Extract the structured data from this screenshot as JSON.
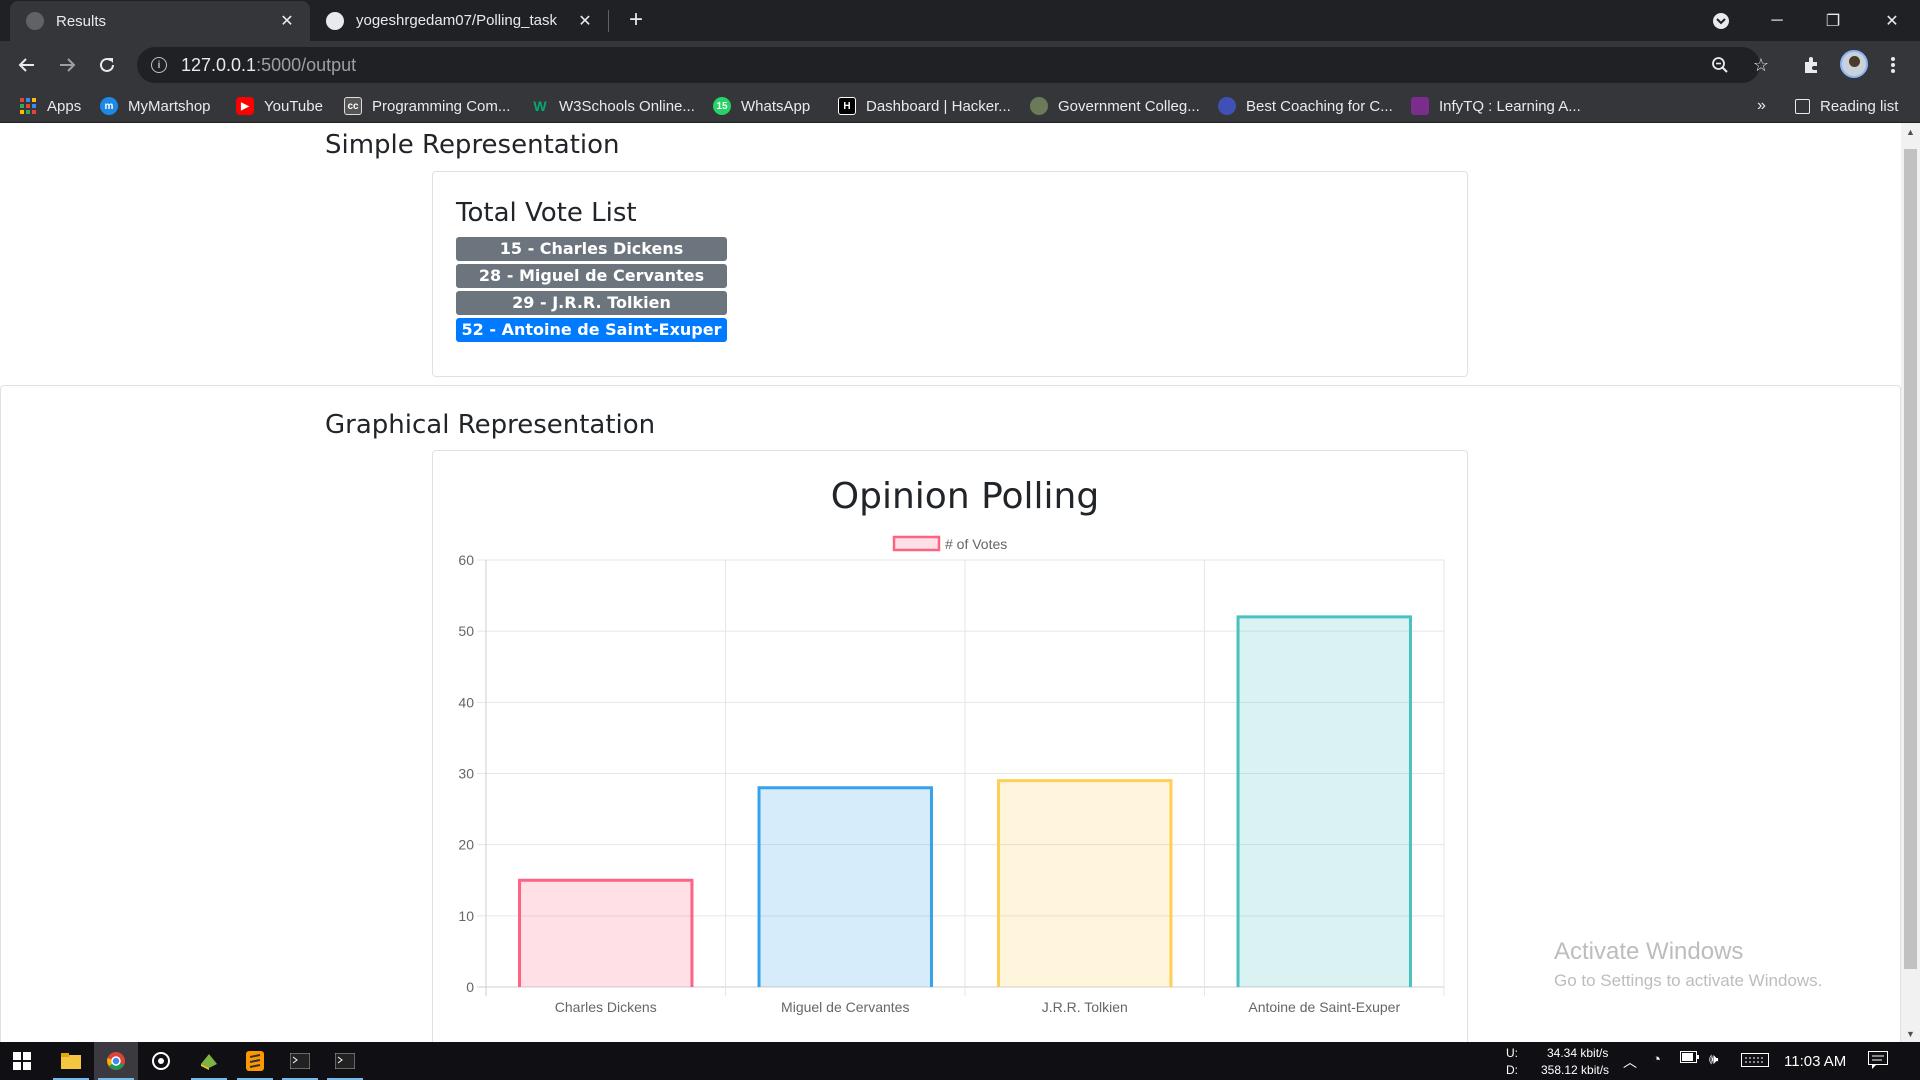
{
  "browser": {
    "tabs": [
      {
        "title": "Results",
        "active": true
      },
      {
        "title": "yogeshrgedam07/Polling_task",
        "active": false
      }
    ],
    "url_host": "127.0.0.1",
    "url_path": ":5000/output",
    "bookmarks": [
      {
        "label": "Apps",
        "icon": "apps-grid-icon",
        "color": "#4285f4"
      },
      {
        "label": "MyMartshop",
        "icon": "mymartshop-icon",
        "color": "#1e88e5"
      },
      {
        "label": "YouTube",
        "icon": "youtube-icon",
        "color": "#ff0000"
      },
      {
        "label": "Programming Com...",
        "icon": "cc-icon",
        "color": "#555555"
      },
      {
        "label": "W3Schools Online...",
        "icon": "w3schools-icon",
        "color": "#04aa6d"
      },
      {
        "label": "WhatsApp",
        "icon": "whatsapp-icon",
        "color": "#25d366"
      },
      {
        "label": "Dashboard | Hacker...",
        "icon": "hackerrank-icon",
        "color": "#000000"
      },
      {
        "label": "Government Colleg...",
        "icon": "college-icon",
        "color": "#6b7b5a"
      },
      {
        "label": "Best Coaching for C...",
        "icon": "coaching-icon",
        "color": "#3f51b5"
      },
      {
        "label": "InfyTQ : Learning A...",
        "icon": "infytq-icon",
        "color": "#7b2d8e"
      }
    ],
    "overflow_label": "»",
    "reading_list_label": "Reading list"
  },
  "simple": {
    "heading": "Simple Representation",
    "card_title": "Total Vote List",
    "votes": [
      {
        "text": "15 - Charles Dickens",
        "style": "secondary"
      },
      {
        "text": "28 - Miguel de Cervantes",
        "style": "secondary"
      },
      {
        "text": "29 - J.R.R. Tolkien",
        "style": "secondary"
      },
      {
        "text": "52 - Antoine de Saint-Exuper",
        "style": "primary"
      }
    ]
  },
  "graphical": {
    "heading": "Graphical Representation"
  },
  "chart_data": {
    "type": "bar",
    "title": "Opinion Polling",
    "categories": [
      "Charles Dickens",
      "Miguel de Cervantes",
      "J.R.R. Tolkien",
      "Antoine de Saint-Exuper"
    ],
    "series": [
      {
        "name": "# of Votes",
        "values": [
          15,
          28,
          29,
          52
        ]
      }
    ],
    "fill_colors": [
      "rgba(255,99,132,0.2)",
      "rgba(54,162,235,0.2)",
      "rgba(255,206,86,0.2)",
      "rgba(75,192,192,0.2)"
    ],
    "border_colors": [
      "#ff6384",
      "#36a2eb",
      "#ffce56",
      "#4bc0c0"
    ],
    "ylim": [
      0,
      60
    ],
    "yticks": [
      0,
      10,
      20,
      30,
      40,
      50,
      60
    ],
    "grid": true,
    "legend": "top"
  },
  "watermark": {
    "line1": "Activate Windows",
    "line2": "Go to Settings to activate Windows."
  },
  "taskbar": {
    "net_up_label": "U:",
    "net_up": "34.34 kbit/s",
    "net_down_label": "D:",
    "net_down": "358.12 kbit/s",
    "time": "11:03 AM"
  }
}
